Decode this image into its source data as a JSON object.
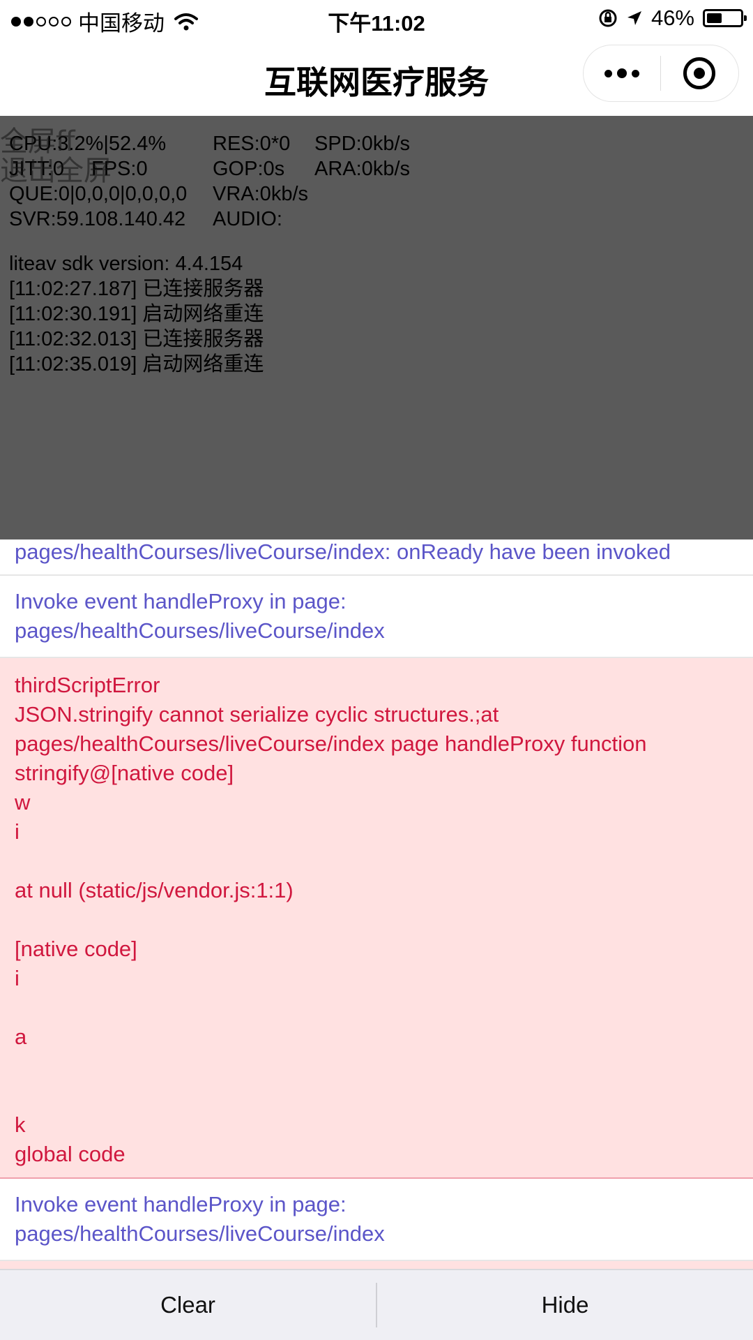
{
  "status_bar": {
    "signal_filled": 2,
    "signal_total": 5,
    "carrier": "中国移动",
    "time": "下午11:02",
    "battery_percent_text": "46%",
    "battery_level": 0.46
  },
  "nav": {
    "title": "互联网医疗服务"
  },
  "player": {
    "fullscreen_label": "全屏ff",
    "exit_fullscreen_label": "退出全屏",
    "stats": [
      [
        "CPU:3.2%|52.4%",
        "RES:0*0",
        "SPD:0kb/s"
      ],
      [
        "JITT:0",
        "FPS:0",
        "GOP:0s",
        "ARA:0kb/s"
      ],
      [
        "QUE:0|0,0,0|0,0,0,0",
        "VRA:0kb/s"
      ],
      [
        "SVR:59.108.140.42",
        "AUDIO:"
      ]
    ],
    "logs": [
      "liteav sdk version: 4.4.154",
      "[11:02:27.187] 已连接服务器",
      "[11:02:30.191] 启动网络重连",
      "[11:02:32.013] 已连接服务器",
      "[11:02:35.019] 启动网络重连"
    ]
  },
  "console": {
    "entries": [
      {
        "level": "log",
        "text": "pages/healthCourses/liveCourse/index: onReady have been invoked"
      },
      {
        "level": "log",
        "text": "Invoke event handleProxy in page:\npages/healthCourses/liveCourse/index"
      },
      {
        "level": "error",
        "text": "thirdScriptError\nJSON.stringify cannot serialize cyclic structures.;at\npages/healthCourses/liveCourse/index page handleProxy function\nstringify@[native code]\nw\ni\n\nat null (static/js/vendor.js:1:1)\n\n[native code]\ni\n\na\n\n\nk\nglobal code"
      },
      {
        "level": "log",
        "text": "Invoke event handleProxy in page:\npages/healthCourses/liveCourse/index"
      }
    ]
  },
  "bottom_bar": {
    "clear_label": "Clear",
    "hide_label": "Hide"
  }
}
